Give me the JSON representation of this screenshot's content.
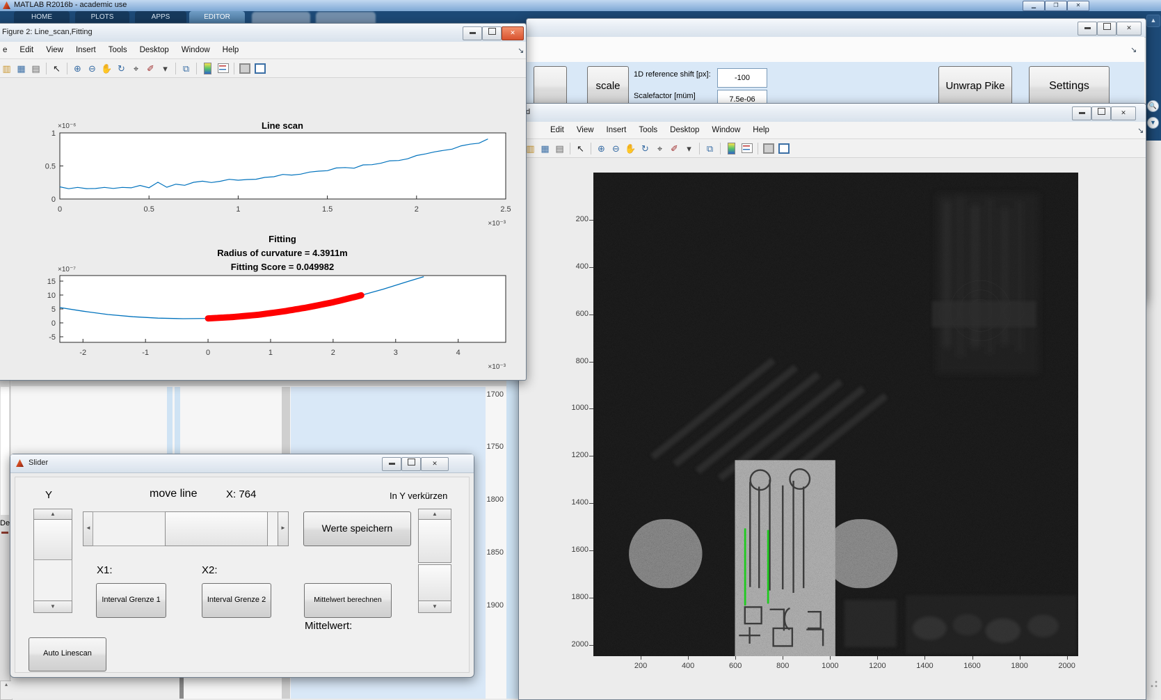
{
  "app": {
    "title": "MATLAB R2016b - academic use",
    "tabs": [
      "HOME",
      "PLOTS",
      "APPS",
      "EDITOR"
    ],
    "active_tab": "EDITOR",
    "window_buttons": [
      "minimize",
      "restore",
      "close"
    ]
  },
  "colors": {
    "matlab_blue": "#0072bd",
    "fit_red": "#ff0000",
    "green_line": "#1ecb1e",
    "panel_blue": "#d9e8f7",
    "ribbon_navy": "#1d4a77",
    "close_red": "#d9532f"
  },
  "figure_toolbar": [
    {
      "name": "new-file-icon",
      "glyph": "▥",
      "color": "#c9962f"
    },
    {
      "name": "save-icon",
      "glyph": "▦",
      "color": "#3a6ea5"
    },
    {
      "name": "print-icon",
      "glyph": "▤",
      "color": "#666666"
    },
    {
      "name": "sep"
    },
    {
      "name": "pointer-icon",
      "glyph": "↖",
      "color": "#222222"
    },
    {
      "name": "sep"
    },
    {
      "name": "zoom-in-icon",
      "glyph": "⊕",
      "color": "#3a6ea5"
    },
    {
      "name": "zoom-out-icon",
      "glyph": "⊖",
      "color": "#3a6ea5"
    },
    {
      "name": "pan-icon",
      "glyph": "✋",
      "color": "#b8912f"
    },
    {
      "name": "rotate-icon",
      "glyph": "↻",
      "color": "#3a6ea5"
    },
    {
      "name": "data-cursor-icon",
      "glyph": "⌖",
      "color": "#333333"
    },
    {
      "name": "brush-icon",
      "glyph": "✐",
      "color": "#a03030"
    },
    {
      "name": "dropdown-caret-icon",
      "glyph": "▾",
      "color": "#444444"
    },
    {
      "name": "sep"
    },
    {
      "name": "link-plots-icon",
      "glyph": "⧉",
      "color": "#3a6ea5"
    },
    {
      "name": "sep"
    },
    {
      "name": "colorbar-icon",
      "css": "ic-colorbar"
    },
    {
      "name": "legend-icon",
      "css": "ic-legend"
    },
    {
      "name": "sep"
    },
    {
      "name": "dock-figure-icon",
      "css": "ic-dock"
    },
    {
      "name": "undock-figure-icon",
      "css": "ic-dock blue"
    }
  ],
  "figure2": {
    "title": "Figure 2: Line_scan,Fitting",
    "menu": [
      "e",
      "Edit",
      "View",
      "Insert",
      "Tools",
      "Desktop",
      "Window",
      "Help"
    ],
    "dock_arrow": "↘",
    "line_scan": {
      "title": "Line scan",
      "y_exponent": "×10⁻⁶",
      "x_exponent": "×10⁻³",
      "ytick_labels": [
        "0",
        "0.5",
        "1"
      ],
      "xtick_labels": [
        "0",
        "0.5",
        "1",
        "1.5",
        "2",
        "2.5"
      ]
    },
    "fitting": {
      "title": "Fitting",
      "subtitle1": "Radius of curvature = 4.3911m",
      "subtitle2": "Fitting Score = 0.049982",
      "y_exponent": "×10⁻⁷",
      "x_exponent": "×10⁻³",
      "ytick_labels": [
        "-5",
        "0",
        "5",
        "10",
        "15"
      ],
      "xtick_labels": [
        "-2",
        "-1",
        "0",
        "1",
        "2",
        "3",
        "4"
      ]
    }
  },
  "gui_panel": {
    "scale_button": "scale",
    "ref_shift_label": "1D reference shift [px]:",
    "ref_shift_value": "-100",
    "scalefactor_label": "Scalefactor [müm]",
    "scalefactor_value": "7.5e-06",
    "unwrap_button": "Unwrap Pike",
    "settings_button": "Settings",
    "dock_arrow": "↘"
  },
  "image_figure": {
    "title_fragment": "d",
    "menu": [
      "Edit",
      "View",
      "Insert",
      "Tools",
      "Desktop",
      "Window",
      "Help"
    ],
    "dock_arrow": "↘",
    "xticks": [
      200,
      400,
      600,
      800,
      1000,
      1200,
      1400,
      1600,
      1800,
      2000
    ],
    "yticks": [
      200,
      400,
      600,
      800,
      1000,
      1200,
      1400,
      1600,
      1800,
      2000
    ]
  },
  "slider_window": {
    "title": "Slider",
    "y_label": "Y",
    "move_line_label": "move line",
    "x_readout": "X: 764",
    "shorten_label": "In Y verkürzen",
    "save_button": "Werte speichern",
    "x1_label": "X1:",
    "x2_label": "X2:",
    "interval1_button": "Interval Grenze 1",
    "interval2_button": "Interval Grenze 2",
    "mean_button": "Mittelwert berechnen",
    "mean_label": "Mittelwert:",
    "auto_button": "Auto Linescan"
  },
  "background_window": {
    "axis_labels": [
      "1700",
      "1750",
      "1800",
      "1850",
      "1900"
    ],
    "det_fragment": "Det"
  },
  "chart_data": [
    {
      "type": "line",
      "title": "Line scan",
      "xlabel": "",
      "ylabel": "",
      "x_scale": "1e-3",
      "y_scale": "1e-6",
      "xlim": [
        0,
        2.5
      ],
      "ylim": [
        0,
        1
      ],
      "xticks": [
        0,
        0.5,
        1,
        1.5,
        2,
        2.5
      ],
      "yticks": [
        0,
        0.5,
        1
      ],
      "line_color": "#0072bd",
      "x_step": 0.05,
      "y": [
        0.17,
        0.165,
        0.17,
        0.158,
        0.162,
        0.168,
        0.172,
        0.188,
        0.162,
        0.208,
        0.172,
        0.248,
        0.188,
        0.238,
        0.198,
        0.258,
        0.268,
        0.246,
        0.276,
        0.286,
        0.272,
        0.302,
        0.296,
        0.326,
        0.342,
        0.362,
        0.348,
        0.386,
        0.402,
        0.422,
        0.432,
        0.462,
        0.488,
        0.478,
        0.508,
        0.522,
        0.542,
        0.572,
        0.592,
        0.622,
        0.648,
        0.688,
        0.712,
        0.732,
        0.762,
        0.792,
        0.818,
        0.852,
        0.905
      ]
    },
    {
      "type": "line",
      "title": "Fitting",
      "annotations": [
        "Radius of curvature = 4.3911m",
        "Fitting Score = 0.049982"
      ],
      "x_scale": "1e-3",
      "y_scale": "1e-7",
      "xlim": [
        -2.37,
        4.76
      ],
      "ylim": [
        -7,
        17
      ],
      "xticks": [
        -2,
        -1,
        0,
        1,
        2,
        3,
        4
      ],
      "yticks": [
        -5,
        0,
        5,
        10,
        15
      ],
      "series": [
        {
          "name": "parabolic-fit",
          "color": "#0072bd",
          "x": [
            -2.37,
            -2,
            -1.6,
            -1.2,
            -0.8,
            -0.4,
            0,
            0.4,
            0.8,
            1.2,
            1.6,
            2,
            2.4,
            2.8,
            3.2,
            3.45
          ],
          "y": [
            5.5,
            4.2,
            3.0,
            2.2,
            1.7,
            1.5,
            1.6,
            2.1,
            2.9,
            4.1,
            5.6,
            7.4,
            9.6,
            12.1,
            14.9,
            16.6
          ]
        },
        {
          "name": "measured-data-overlay",
          "color": "#ff0000",
          "x_range": [
            0,
            2.45
          ]
        }
      ]
    },
    {
      "type": "heatmap",
      "title": "",
      "xlim": [
        0,
        2048
      ],
      "ylim": [
        0,
        2048
      ],
      "xticks": [
        200,
        400,
        600,
        800,
        1000,
        1200,
        1400,
        1600,
        1800,
        2000
      ],
      "yticks": [
        200,
        400,
        600,
        800,
        1000,
        1200,
        1400,
        1600,
        1800,
        2000
      ],
      "description": "dark interferometric amplitude image with bright chip structure and bond pads",
      "green_lines": [
        {
          "x": 641,
          "y1": 1510,
          "y2": 1830
        },
        {
          "x": 738,
          "y1": 1517,
          "y2": 1822
        }
      ]
    }
  ]
}
